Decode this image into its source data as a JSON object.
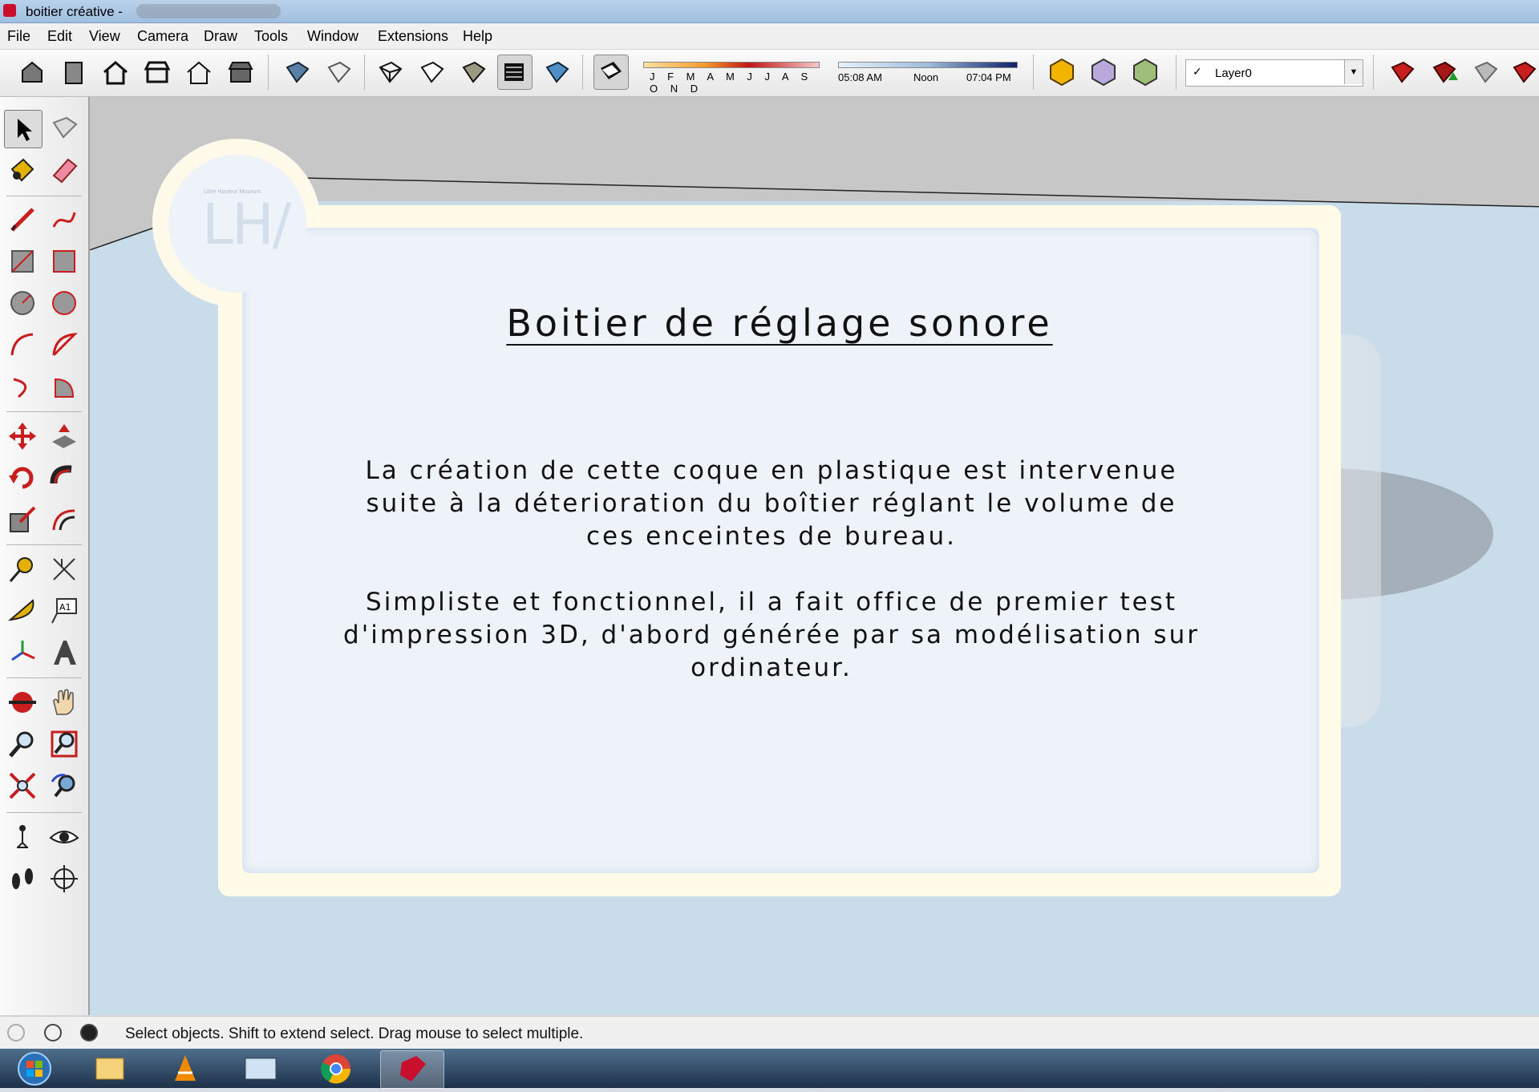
{
  "window": {
    "title": "boitier créative -"
  },
  "menu": [
    "File",
    "Edit",
    "View",
    "Camera",
    "Draw",
    "Tools",
    "Window",
    "Extensions",
    "Help"
  ],
  "shadow": {
    "months": "J F M A M J J A S O N D",
    "time_start": "05:08 AM",
    "time_mid": "Noon",
    "time_end": "07:04 PM"
  },
  "layer": {
    "checkmark": "✓",
    "name": "Layer0"
  },
  "card": {
    "title": "Boitier de réglage sonore",
    "para1_l1": "La création de cette coque en plastique est intervenue",
    "para1_l2": "suite à la déterioration du boîtier réglant le volume de",
    "para1_l3": "ces enceintes de bureau.",
    "para2_l1": "Simpliste et fonctionnel, il a fait office de premier test",
    "para2_l2": "d'impression 3D, d'abord générée par sa modélisation sur",
    "para2_l3": "ordinateur.",
    "logo": "LH/",
    "logo_small": "Libre Hauteur Museum"
  },
  "status": {
    "text": "Select objects. Shift to extend select. Drag mouse to select multiple."
  },
  "colors": {
    "accent_red": "#c8102e",
    "viewport_bg": "#c9dcea"
  }
}
